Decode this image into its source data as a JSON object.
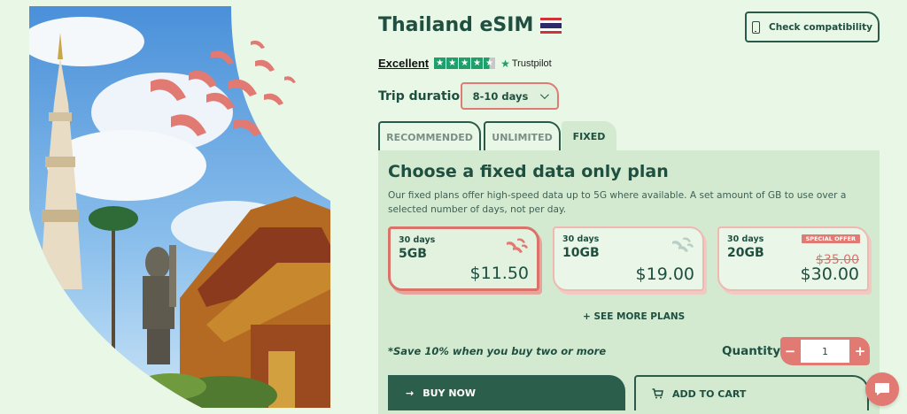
{
  "header": {
    "title": "Thailand eSIM",
    "check_compat_label": "Check compatibility"
  },
  "trustpilot": {
    "rating_text": "Excellent",
    "brand": "Trustpilot",
    "stars": 4.5
  },
  "trip": {
    "label": "Trip duration",
    "selected": "8-10 days"
  },
  "tabs": [
    {
      "label": "RECOMMENDED",
      "active": false
    },
    {
      "label": "UNLIMITED",
      "active": false
    },
    {
      "label": "FIXED",
      "active": true
    }
  ],
  "panel": {
    "title": "Choose a fixed data only plan",
    "description": "Our fixed plans offer high-speed data up to 5G where available. A set amount of GB to use over a selected number of days, not per day."
  },
  "plans": [
    {
      "days": "30 days",
      "data": "5GB",
      "price": "$11.50",
      "selected": true
    },
    {
      "days": "30 days",
      "data": "10GB",
      "price": "$19.00",
      "selected": false
    },
    {
      "days": "30 days",
      "data": "20GB",
      "price": "$30.00",
      "old_price": "$35.00",
      "badge": "SPECIAL OFFER",
      "selected": false
    }
  ],
  "see_more_label": "+ SEE MORE PLANS",
  "save_note": "*Save 10% when you buy two or more",
  "quantity": {
    "label": "Quantity",
    "value": "1",
    "minus": "−",
    "plus": "+"
  },
  "actions": {
    "buy_now": "BUY NOW",
    "add_to_cart": "ADD TO CART"
  },
  "colors": {
    "brand_green": "#2c5e4c",
    "accent_coral": "#e07a72",
    "background": "#e9f7e6",
    "panel": "#d3ead0"
  }
}
